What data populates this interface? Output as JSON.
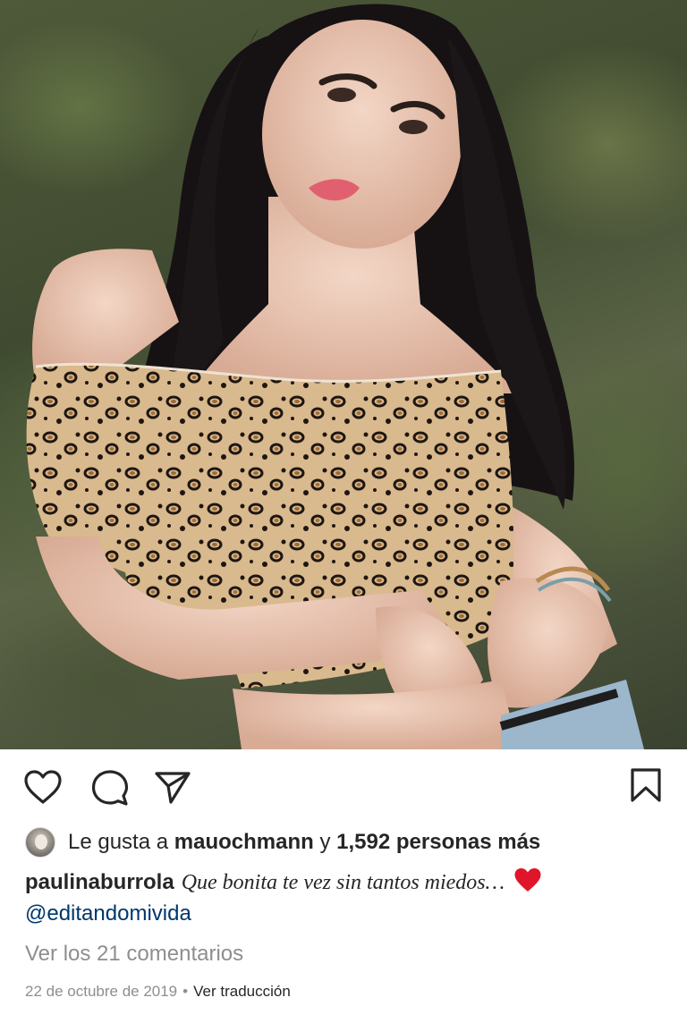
{
  "post": {
    "image_alt": "Foto del post",
    "likes": {
      "prefix": "Le gusta a",
      "user": "mauochmann",
      "connector": "y",
      "count_text": "1,592 personas más"
    },
    "caption": {
      "username": "paulinaburrola",
      "text": "Que bonita te vez sin tantos miedos…",
      "emoji": "heart"
    },
    "mention": "@editandomivida",
    "view_comments": "Ver los 21 comentarios",
    "date": "22 de octubre de 2019",
    "separator": "•",
    "translate": "Ver traducción"
  },
  "actions": {
    "like_icon": "heart-outline-icon",
    "comment_icon": "comment-bubble-icon",
    "share_icon": "paper-plane-icon",
    "save_icon": "bookmark-icon"
  },
  "colors": {
    "text": "#262626",
    "muted": "#8e8e8e",
    "link": "#00376b",
    "heart": "#e0152a"
  }
}
